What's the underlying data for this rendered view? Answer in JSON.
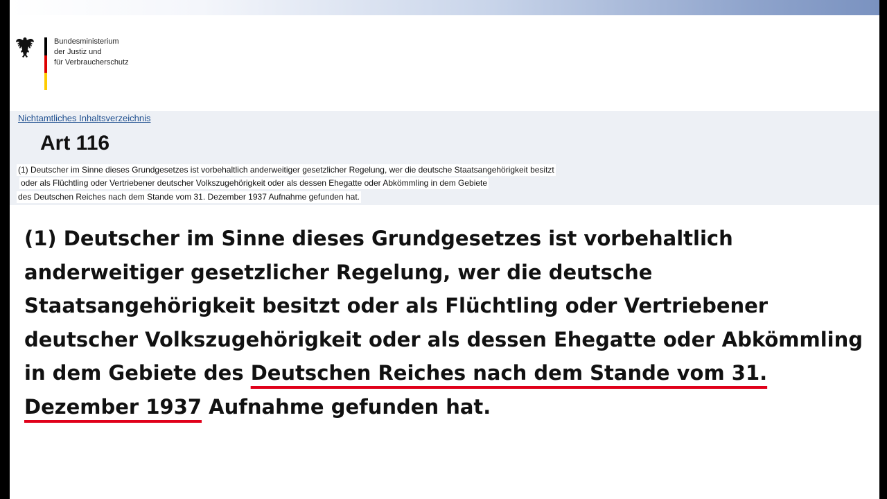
{
  "header": {
    "ministry_lines": [
      "Bundesministerium",
      "der Justiz und",
      "für Verbraucherschutz"
    ]
  },
  "nav": {
    "toc_link": "Nichtamtliches Inhaltsverzeichnis"
  },
  "article": {
    "title": "Art 116",
    "original_lines": [
      "(1) Deutscher im Sinne dieses Grundgesetzes ist vorbehaltlich anderweitiger gesetzlicher Regelung, wer die deutsche Staatsangehörigkeit besitzt",
      "oder als Flüchtling oder Vertriebener deutscher Volkszugehörigkeit oder als dessen Ehegatte oder Abkömmling in dem Gebiete",
      "des Deutschen Reiches nach dem Stande vom 31. Dezember 1937 Aufnahme gefunden hat."
    ]
  },
  "enlarged": {
    "part1": "(1) Deutscher im Sinne dieses Grundgesetzes ist vorbehaltlich anderweitiger gesetzlicher Regelung, wer die deutsche Staatsangehörigkeit besitzt oder als Flüchtling oder Vertriebener deutscher Volkszugehörigkeit oder als dessen Ehegatte oder Abkömmling in dem Gebiete des ",
    "highlight": "Deutschen Reiches nach dem Stande vom 31. Dezember 1937",
    "part2": " Aufnahme gefunden hat."
  },
  "colors": {
    "underline": "#e0001a",
    "link": "#1f4f8f",
    "band": "#edf0f5"
  }
}
